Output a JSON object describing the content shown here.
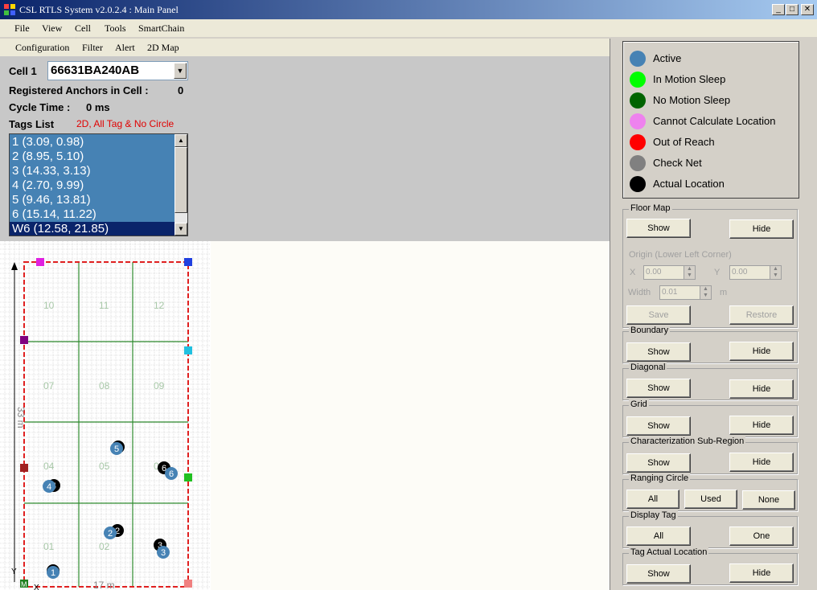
{
  "window": {
    "title": "CSL RTLS System v2.0.2.4 : Main Panel"
  },
  "menu": [
    "File",
    "View",
    "Cell",
    "Tools",
    "SmartChain"
  ],
  "toolbar_menu": [
    "Configuration",
    "Filter",
    "Alert",
    "2D Map"
  ],
  "cell": {
    "label": "Cell 1",
    "value": "66631BA240AB"
  },
  "registered_anchors": {
    "label": "Registered Anchors in Cell :",
    "value": "0"
  },
  "cycle_time": {
    "label": "Cycle Time :",
    "value": "0 ms"
  },
  "tags_list": {
    "label": "Tags List",
    "mode": "2D, All Tag & No Circle",
    "items": [
      "1 (3.09, 0.98)",
      "2 (8.95, 5.10)",
      "3 (14.33, 3.13)",
      "4 (2.70, 9.99)",
      "5 (9.46, 13.81)",
      "6 (15.14, 11.22)",
      "W6 (12.58, 21.85)"
    ],
    "selected_index": 6
  },
  "map": {
    "width_label": "17 m",
    "height_label": "33 m",
    "axis_y": "Y",
    "axis_x": "X",
    "anchor_origin_label": "M",
    "region_labels": [
      "10",
      "11",
      "12",
      "07",
      "08",
      "09",
      "04",
      "05",
      "06",
      "01",
      "02",
      "03"
    ],
    "tags": [
      {
        "id": "1",
        "type": "estimated"
      },
      {
        "id": "2",
        "type": "estimated"
      },
      {
        "id": "3",
        "type": "estimated"
      },
      {
        "id": "4",
        "type": "estimated"
      },
      {
        "id": "5",
        "type": "estimated"
      },
      {
        "id": "6",
        "type": "estimated"
      }
    ],
    "colors": {
      "grid_minor": "#c8c8c8",
      "grid_major": "#2e8b2e",
      "boundary": "#e02020",
      "tag_estimated": "#4682b4",
      "tag_actual": "#000000"
    }
  },
  "legend": [
    {
      "label": "Active",
      "color": "#4682b4"
    },
    {
      "label": "In Motion Sleep",
      "color": "#00ff00"
    },
    {
      "label": "No Motion Sleep",
      "color": "#006400"
    },
    {
      "label": "Cannot Calculate Location",
      "color": "#ee82ee"
    },
    {
      "label": "Out of Reach",
      "color": "#ff0000"
    },
    {
      "label": "Check Net",
      "color": "#808080"
    },
    {
      "label": "Actual Location",
      "color": "#000000"
    }
  ],
  "floor_map": {
    "title": "Floor Map",
    "show": "Show",
    "hide": "Hide",
    "origin_label": "Origin (Lower Left Corner)",
    "x_label": "X",
    "x_value": "0.00",
    "y_label": "Y",
    "y_value": "0.00",
    "width_label": "Width",
    "width_value": "0.01",
    "unit": "m",
    "save": "Save",
    "restore": "Restore"
  },
  "boundary": {
    "title": "Boundary",
    "show": "Show",
    "hide": "Hide"
  },
  "diagonal": {
    "title": "Diagonal",
    "show": "Show",
    "hide": "Hide"
  },
  "grid": {
    "title": "Grid",
    "show": "Show",
    "hide": "Hide"
  },
  "subregion": {
    "title": "Characterization Sub-Region",
    "show": "Show",
    "hide": "Hide"
  },
  "ranging_circle": {
    "title": "Ranging Circle",
    "all": "All",
    "used": "Used",
    "none": "None"
  },
  "display_tag": {
    "title": "Display Tag",
    "all": "All",
    "one": "One"
  },
  "tag_actual_location": {
    "title": "Tag Actual Location",
    "show": "Show",
    "hide": "Hide"
  }
}
